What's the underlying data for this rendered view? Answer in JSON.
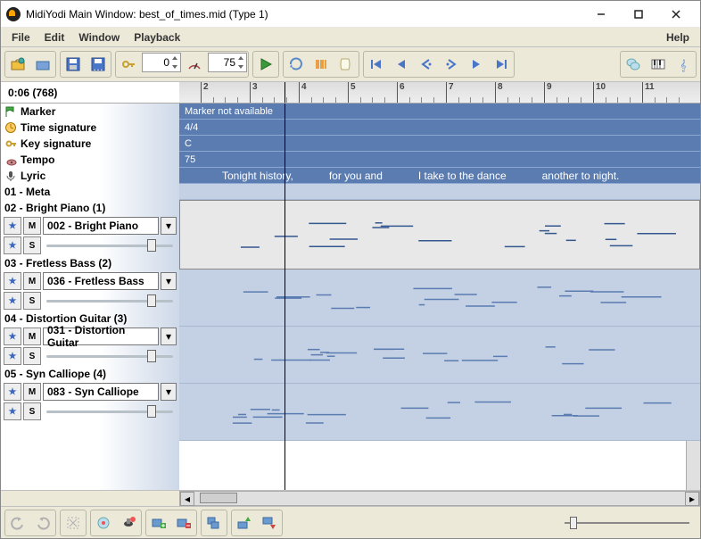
{
  "window": {
    "title": "MidiYodi Main Window: best_of_times.mid (Type 1)"
  },
  "menu": {
    "file": "File",
    "edit": "Edit",
    "window": "Window",
    "playback": "Playback",
    "help": "Help"
  },
  "toolbar": {
    "offset": "0",
    "tempo": "75"
  },
  "time": {
    "display": "0:06 (768)"
  },
  "info": {
    "marker_label": "Marker",
    "marker_value": "Marker not available",
    "timesig_label": "Time signature",
    "timesig_value": "4/4",
    "keysig_label": "Key signature",
    "keysig_value": "C",
    "tempo_label": "Tempo",
    "tempo_value": "75",
    "lyric_label": "Lyric",
    "lyric_segments": [
      "Tonight history,",
      "for you and",
      "I take to the dance",
      "another to night."
    ]
  },
  "ruler": {
    "bars": [
      2,
      3,
      4,
      5,
      6,
      7,
      8,
      9,
      10,
      11
    ]
  },
  "tracks": [
    {
      "title": "01 - Meta"
    },
    {
      "title": "02 - Bright Piano (1)",
      "instrument": "002 - Bright Piano",
      "selected": true
    },
    {
      "title": "03 - Fretless Bass (2)",
      "instrument": "036 - Fretless Bass"
    },
    {
      "title": "04 - Distortion Guitar (3)",
      "instrument": "031 - Distortion Guitar"
    },
    {
      "title": "05 - Syn Calliope (4)",
      "instrument": "083 - Syn Calliope"
    }
  ],
  "labels": {
    "mute": "M",
    "solo": "S"
  }
}
